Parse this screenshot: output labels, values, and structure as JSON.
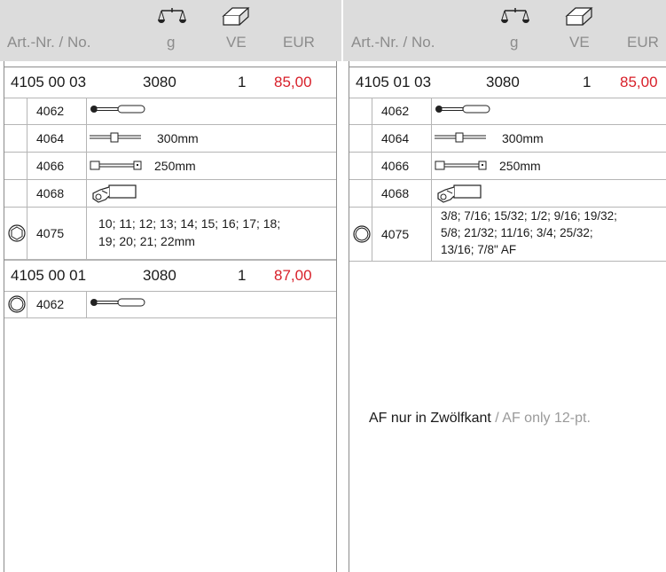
{
  "header": {
    "left": {
      "artnr": "Art.-Nr. / No.",
      "g": "g",
      "ve": "VE",
      "eur": "EUR"
    },
    "right": {
      "artnr": "Art.-Nr. / No.",
      "g": "g",
      "ve": "VE",
      "eur": "EUR"
    }
  },
  "left": {
    "items": [
      {
        "artnr": "4105 00 03",
        "g": "3080",
        "ve": "1",
        "price": "85,00",
        "parts": [
          {
            "num": "4062",
            "tool": "ratchet-icon",
            "text": ""
          },
          {
            "num": "4064",
            "tool": "extension-bar-icon",
            "text": "300mm"
          },
          {
            "num": "4066",
            "tool": "extension-icon",
            "text": "250mm"
          },
          {
            "num": "4068",
            "tool": "adapter-icon",
            "text": ""
          }
        ],
        "socket": {
          "num": "4075",
          "sizes1": "10; 11; 12; 13; 14; 15; 16; 17; 18;",
          "sizes2": "19; 20; 21; 22mm"
        }
      },
      {
        "artnr": "4105 00 01",
        "g": "3080",
        "ve": "1",
        "price": "87,00",
        "parts": [
          {
            "num": "4062",
            "tool": "ratchet-icon",
            "text": ""
          }
        ]
      }
    ]
  },
  "right": {
    "items": [
      {
        "artnr": "4105 01 03",
        "g": "3080",
        "ve": "1",
        "price": "85,00",
        "parts": [
          {
            "num": "4062",
            "tool": "ratchet-icon",
            "text": ""
          },
          {
            "num": "4064",
            "tool": "extension-bar-icon",
            "text": "300mm"
          },
          {
            "num": "4066",
            "tool": "extension-icon",
            "text": "250mm"
          },
          {
            "num": "4068",
            "tool": "adapter-icon",
            "text": ""
          }
        ],
        "socket": {
          "num": "4075",
          "sizes1": "3/8; 7/16; 15/32; 1/2; 9/16; 19/32;",
          "sizes2": "5/8; 21/32; 11/16; 3/4; 25/32;",
          "sizes3": "13/16; 7/8\" AF"
        }
      }
    ],
    "note_de": "AF nur in Zwölfkant",
    "note_sep": " / ",
    "note_en": "AF only 12-pt."
  },
  "colors": {
    "price": "#d8202a",
    "header_bg": "#dcdcdc",
    "header_text": "#8c8c8c"
  }
}
